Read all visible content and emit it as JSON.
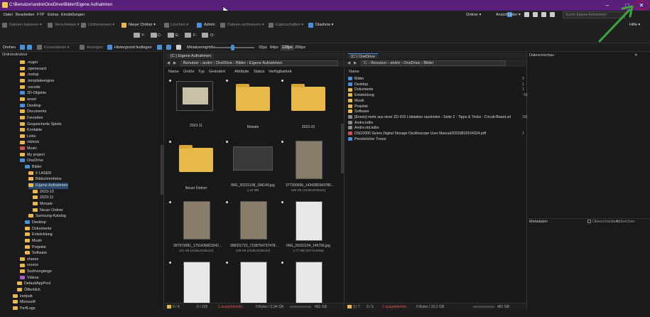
{
  "window": {
    "title": "C:\\Benutzer\\andre\\OneDrive\\Bilder\\Eigene Aufnahmen",
    "min": "–",
    "max": "□",
    "close": "✕"
  },
  "menu": [
    "Datei",
    "Bearbeiten",
    "FTP",
    "Extras",
    "Einstellungen"
  ],
  "menu_right": {
    "view": "Ansicht ▾",
    "folders": "Ordner ▾",
    "lists": "Lister ▾",
    "search_placeholder": "Suche Eigene Aufnahmen",
    "help": "Hilfe ▾"
  },
  "toolbar1": {
    "copy": "Dateien kopieren ▾",
    "move": "Verschieben ▾",
    "rename": "Umbenennen ▾",
    "new_folder": "Neuer Ordner ▾",
    "delete": "Löschen ▾",
    "admin": "Admin",
    "archive": "Dateien archivieren ▾",
    "properties": "Eigenschaften ▾",
    "slideshow": "Diashow ▾"
  },
  "drives": [
    "Y:",
    "C:",
    "E:",
    "F:",
    "O:"
  ],
  "toolbar2": {
    "rotate": "Drehen",
    "convert": "Konvertieren ▾",
    "show": "Anzeigen",
    "wallpaper": "Hintergrund festlegen",
    "thumbsize": "Miniaturengröße",
    "sizes": [
      "32px",
      "64px",
      "128px",
      "256px"
    ],
    "active_size": "128px"
  },
  "tree": {
    "header": "Ordnerstruktur",
    "items": [
      {
        "label": ".nuget",
        "c": ""
      },
      {
        "label": ".openecard",
        "c": ""
      },
      {
        "label": ".rustup",
        "c": ""
      },
      {
        "label": ".templateengine",
        "c": ""
      },
      {
        "label": ".vscode",
        "c": ""
      },
      {
        "label": "3D-Objekte",
        "c": "b"
      },
      {
        "label": "ansel",
        "c": ""
      },
      {
        "label": "Desktop",
        "c": "b"
      },
      {
        "label": "Documents",
        "c": ""
      },
      {
        "label": "Favoriten",
        "c": ""
      },
      {
        "label": "Gespeicherte Spiele",
        "c": ""
      },
      {
        "label": "Kontakte",
        "c": ""
      },
      {
        "label": "Links",
        "c": ""
      },
      {
        "label": "mblock",
        "c": ""
      },
      {
        "label": "Music",
        "c": "r"
      },
      {
        "label": "My project",
        "c": ""
      },
      {
        "label": "OneDrive",
        "c": "b"
      },
      {
        "label": "Bilder",
        "c": "b"
      },
      {
        "label": "# LASER",
        "c": ""
      },
      {
        "label": "Bildschirmfotos",
        "c": ""
      },
      {
        "label": "Eigene Aufnahmen",
        "c": ""
      },
      {
        "label": "2023-10",
        "c": ""
      },
      {
        "label": "2023-11",
        "c": ""
      },
      {
        "label": "Monate",
        "c": ""
      },
      {
        "label": "Neuer Ordner",
        "c": ""
      },
      {
        "label": "Samsung-Katalog",
        "c": ""
      },
      {
        "label": "Desktop",
        "c": "b"
      },
      {
        "label": "Dokumente",
        "c": ""
      },
      {
        "label": "Entwicklung",
        "c": ""
      },
      {
        "label": "Musik",
        "c": ""
      },
      {
        "label": "Projekte",
        "c": ""
      },
      {
        "label": "Software",
        "c": ""
      },
      {
        "label": "shares",
        "c": ""
      },
      {
        "label": "source",
        "c": ""
      },
      {
        "label": "Suchvorgänge",
        "c": ""
      },
      {
        "label": "Videos",
        "c": "p"
      },
      {
        "label": "DefaultAppPool",
        "c": ""
      },
      {
        "label": "Öffentlich",
        "c": ""
      },
      {
        "label": "inetpub",
        "c": ""
      },
      {
        "label": "Microsoft",
        "c": ""
      },
      {
        "label": "PerfLogs",
        "c": ""
      }
    ]
  },
  "left_pane": {
    "tab": "(C:) Eigene Aufnahmen",
    "path": "Benutzer  ›  andre  ›  OneDrive  ›  Bilder  ›  Eigene Aufnahmen",
    "columns": [
      "Name",
      "Größe",
      "Typ",
      "Geändert",
      "Attribute",
      "Status",
      "Verfügbarkeit"
    ],
    "items": [
      {
        "label": "2023-11",
        "sub": "",
        "kind": "doc-dark"
      },
      {
        "label": "Monate",
        "sub": "",
        "kind": "folder"
      },
      {
        "label": "2023-10",
        "sub": "",
        "kind": "folder"
      },
      {
        "label": "Neuer Ordner",
        "sub": "",
        "kind": "folder"
      },
      {
        "label": "IMG_20231108_184149.jpg",
        "sub": "2,20 MB",
        "kind": "dark"
      },
      {
        "label": "377200996_1434280343785...",
        "sub": "180 KB (1536x2048x24)",
        "kind": "photo"
      },
      {
        "label": "397973081_1751436823242...",
        "sub": "131 KB (1536x2048x24)",
        "kind": "photo"
      },
      {
        "label": "398311715_7158754737478...",
        "sub": "189 KB (1536x2048x24)",
        "kind": "photo"
      },
      {
        "label": "IMG_20231104_145756.jpg",
        "sub": "2,77 MB (3072x4096)",
        "kind": "doc"
      },
      {
        "label": "",
        "sub": "",
        "kind": "doc"
      },
      {
        "label": "",
        "sub": "",
        "kind": "doc"
      },
      {
        "label": "",
        "sub": "",
        "kind": "doc"
      }
    ],
    "status": {
      "count": "0 / 4",
      "files": "0 / 229",
      "selected": "1 ausgeblendet",
      "bytes": "0 Bytes / 2,94 GB",
      "free": "481 GB"
    }
  },
  "right_pane": {
    "tab": "(C:) OneDrive",
    "path": "C:  ›  Benutzer  ›  andre  ›  OneDrive  ›  Bilder",
    "columns": [
      "Name"
    ],
    "items": [
      {
        "label": "Bilder",
        "c": "b",
        "size": "2"
      },
      {
        "label": "Desktop",
        "c": "b",
        "size": "1"
      },
      {
        "label": "Dokumente",
        "c": "",
        "size": "1"
      },
      {
        "label": "Entwicklung",
        "c": "",
        "size": "~5("
      },
      {
        "label": "Musik",
        "c": "",
        "size": ""
      },
      {
        "label": "Projekte",
        "c": "",
        "size": ""
      },
      {
        "label": "Software",
        "c": "",
        "size": ""
      },
      {
        "label": "[Ersetz] mehr aus einer ZD-915 Lötstation rausholen - Seite 2 - Tipps & Tricks - Circuit-Board.url",
        "c": "g",
        "size": "18("
      },
      {
        "label": "Andre.kdbx",
        "c": "g",
        "size": ""
      },
      {
        "label": "Andre.old.kdbx",
        "c": "g",
        "size": ""
      },
      {
        "label": "DSO2000 Series Digital Storage Oscilloscope User Manual20220818164324.pdf",
        "c": "r",
        "size": "1"
      },
      {
        "label": "Persönlicher Tresor",
        "c": "b",
        "size": ""
      }
    ],
    "status": {
      "count": "0 / 7",
      "files": "0 / 5",
      "selected": "2 ausgeblendet",
      "bytes": "0 Bytes / 32,2 GB",
      "free": "481 GB"
    }
  },
  "side": {
    "preview": "Dateivorschau",
    "meta": "Metadaten",
    "overwrite": "Überschreiben",
    "cancel": "Abbrechen"
  },
  "colors": {
    "title": "#5a1f7a",
    "accent": "#3ea63e",
    "close": "#c8102e"
  }
}
